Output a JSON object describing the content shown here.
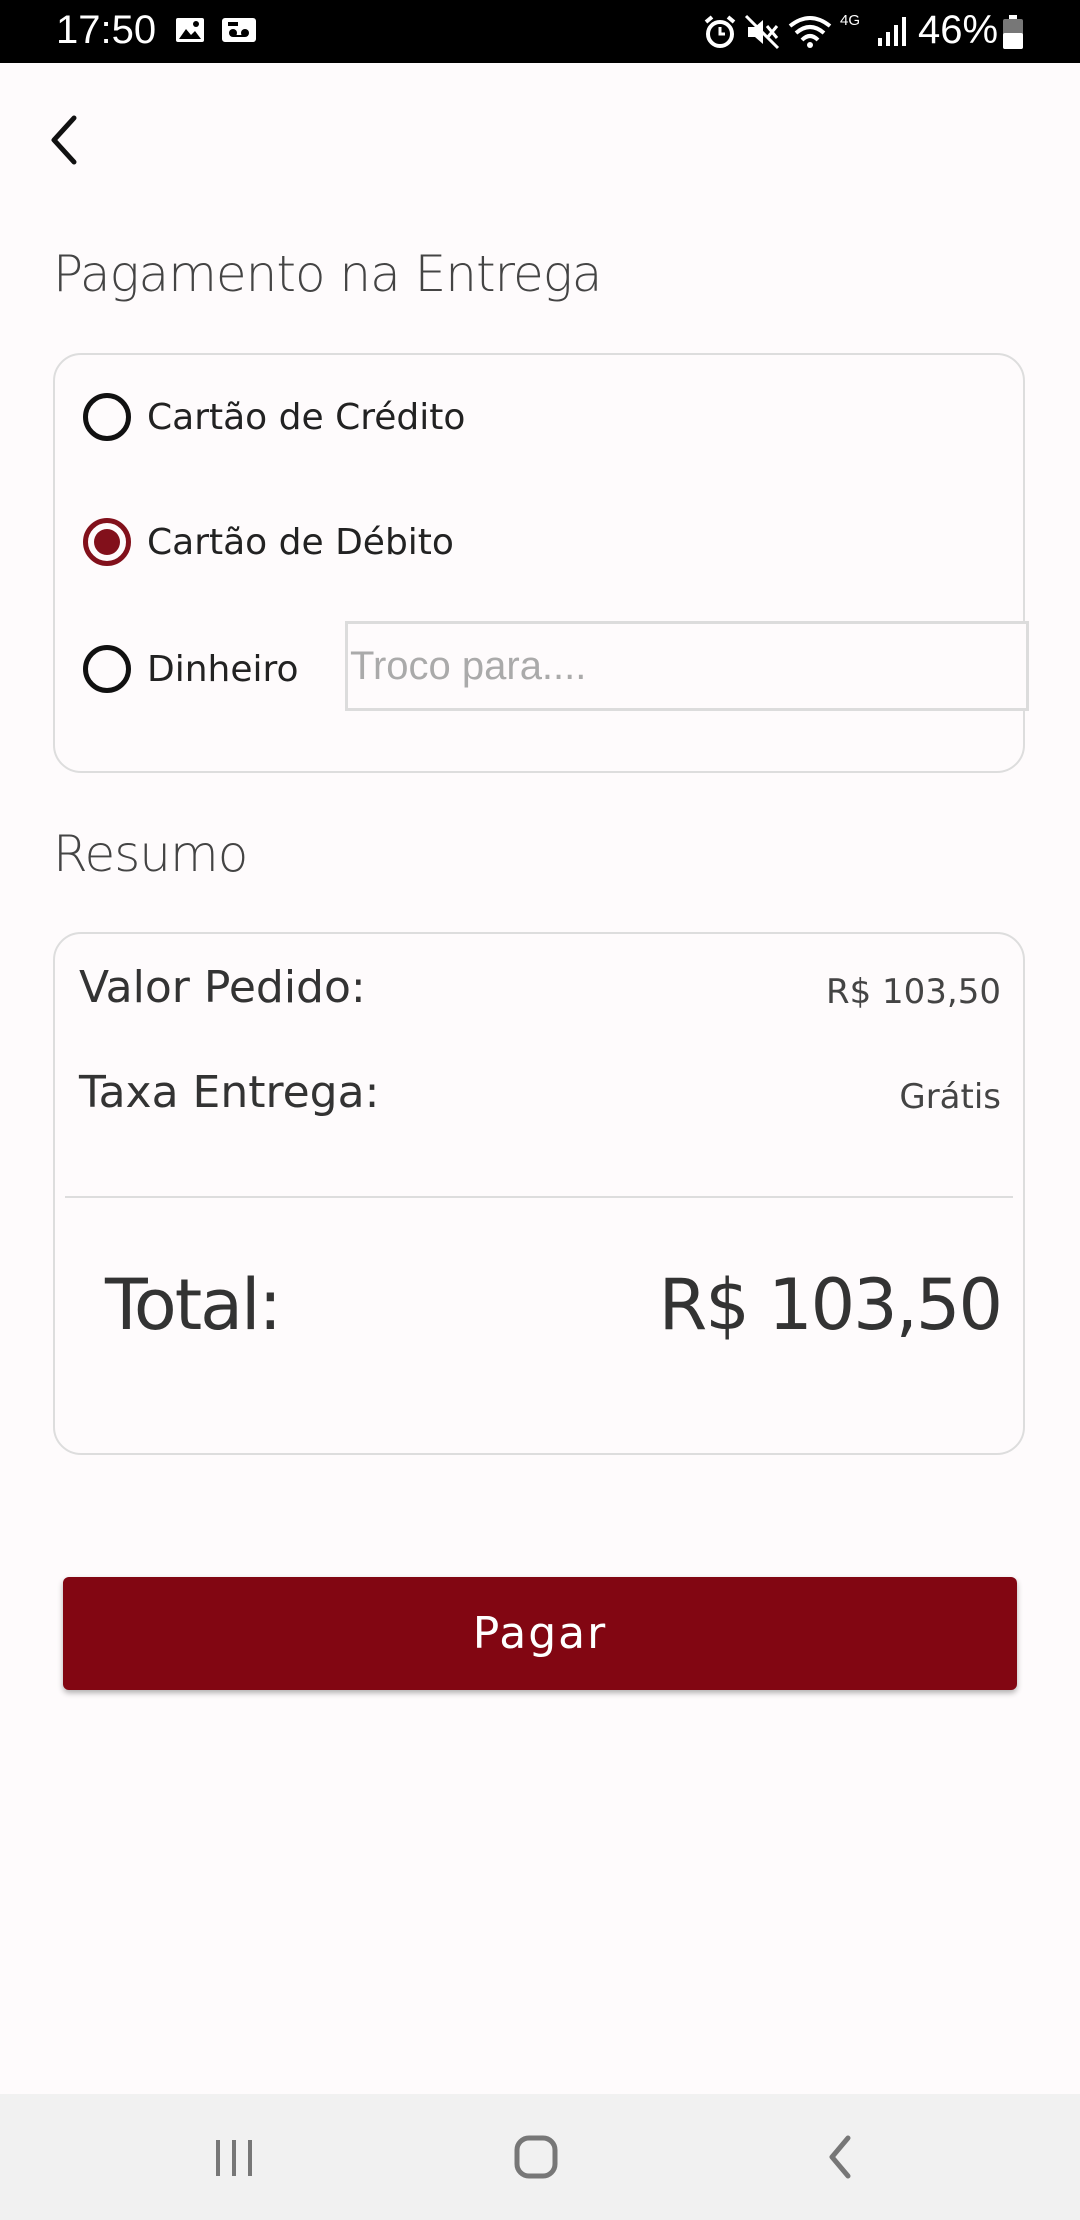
{
  "status_bar": {
    "time": "17:50",
    "network": "4G",
    "battery": "46%"
  },
  "payment": {
    "title": "Pagamento na Entrega",
    "options": [
      {
        "label": "Cartão de Crédito",
        "selected": false
      },
      {
        "label": "Cartão de Débito",
        "selected": true
      },
      {
        "label": "Dinheiro",
        "selected": false
      }
    ],
    "change_input": {
      "placeholder": "Troco para....",
      "value": ""
    }
  },
  "summary": {
    "title": "Resumo",
    "order_value_label": "Valor Pedido:",
    "order_value": "R$ 103,50",
    "delivery_fee_label": "Taxa Entrega:",
    "delivery_fee": "Grátis",
    "total_label": "Total:",
    "total_value": "R$ 103,50"
  },
  "pay_button": {
    "label": "Pagar"
  },
  "colors": {
    "accent": "#820612",
    "background": "#fefbfc"
  }
}
